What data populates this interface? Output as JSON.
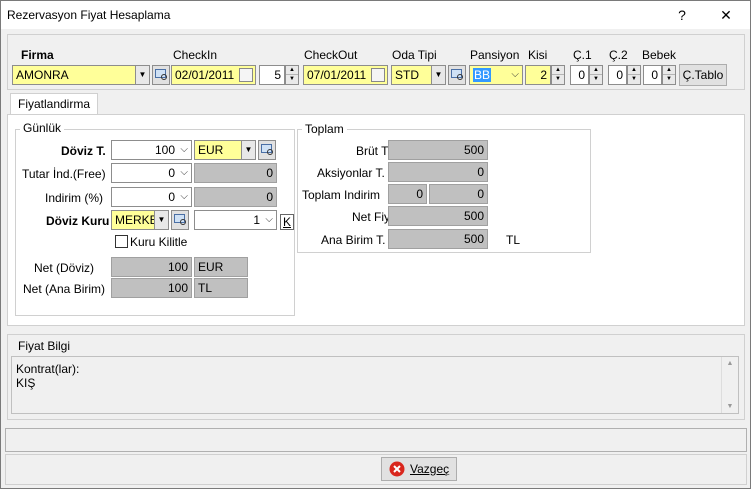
{
  "window": {
    "title": "Rezervasyon Fiyat Hesaplama",
    "help_glyph": "?",
    "close_glyph": "✕"
  },
  "header": {
    "firma_label": "Firma",
    "firma_value": "AMONRA",
    "checkin_label": "CheckIn",
    "checkin_value": "02/01/2011",
    "nights_value": "5",
    "checkout_label": "CheckOut",
    "checkout_value": "07/01/2011",
    "oda_tipi_label": "Oda Tipi",
    "oda_tipi_value": "STD",
    "pansiyon_label": "Pansiyon",
    "pansiyon_value": "BB",
    "kisi_label": "Kisi",
    "kisi_value": "2",
    "c1_label": "Ç.1",
    "c1_value": "0",
    "c2_label": "Ç.2",
    "c2_value": "0",
    "bebek_label": "Bebek",
    "bebek_value": "0",
    "ctablo_label": "Ç.Tablo"
  },
  "tabs": [
    {
      "label": "Fiyatlandirma"
    }
  ],
  "gunluk": {
    "title": "Günlük",
    "doviz_t_label": "Döviz T.",
    "doviz_t_amount": "100",
    "doviz_t_currency": "EUR",
    "tutar_label": "Tutar İnd.(Free)",
    "tutar_value": "0",
    "tutar_result": "0",
    "indirim_label": "Indirim (%)",
    "indirim_value": "0",
    "indirim_result": "0",
    "doviz_kuru_label": "Döviz Kuru",
    "doviz_kuru_source": "MERKEZ",
    "doviz_kuru_value": "1",
    "k_label": "K",
    "kuru_kilitle_label": "Kuru Kilitle",
    "kuru_kilitle_checked": false,
    "net_doviz_label": "Net (Döviz)",
    "net_doviz_value": "100",
    "net_doviz_currency": "EUR",
    "net_ana_label": "Net (Ana Birim)",
    "net_ana_value": "100",
    "net_ana_currency": "TL"
  },
  "toplam": {
    "title": "Toplam",
    "brut_label": "Brüt T",
    "brut_value": "500",
    "aksiyonlar_label": "Aksiyonlar T.",
    "aksiyonlar_value": "0",
    "toplam_indirim_label": "Toplam Indirim",
    "toplam_indirim_a": "0",
    "toplam_indirim_b": "0",
    "net_fiyat_label": "Net Fiyat",
    "net_fiyat_value": "500",
    "ana_birim_label": "Ana Birim T.",
    "ana_birim_value": "500",
    "ana_birim_currency": "TL"
  },
  "fiyat_bilgi": {
    "title": "Fiyat Bilgi",
    "line1": "Kontrat(lar):",
    "line2": "KIŞ"
  },
  "footer": {
    "vazgec_label": "Vazgeç"
  },
  "colors": {
    "yellow_field": "#ffff99",
    "gray_field": "#c0c0c0",
    "selection_blue": "#3399ff",
    "cancel_red": "#d9261c"
  }
}
